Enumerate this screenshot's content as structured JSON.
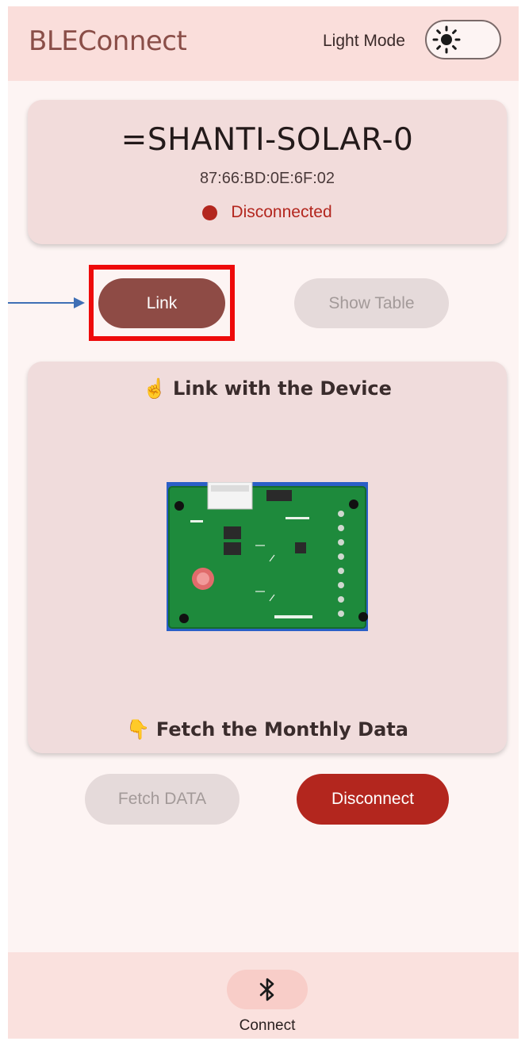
{
  "app": {
    "title": "BLEConnect",
    "mode_label": "Light Mode",
    "mode_icon": "sun-icon"
  },
  "device": {
    "name": "=SHANTI-SOLAR-0",
    "mac": "87:66:BD:0E:6F:02",
    "status": "Disconnected",
    "status_color": "#b3261e"
  },
  "actions": {
    "link_label": "Link",
    "show_table_label": "Show Table",
    "fetch_label": "Fetch DATA",
    "disconnect_label": "Disconnect"
  },
  "info": {
    "top_emoji": "☝️",
    "top_text": "Link with the Device",
    "bottom_emoji": "👇",
    "bottom_text": "Fetch the Monthly Data",
    "image_icon": "circuit-board-image"
  },
  "nav": {
    "items": [
      {
        "label": "Connect",
        "icon": "bluetooth-icon",
        "selected": true
      }
    ]
  },
  "annotation": {
    "highlight_color": "#ee0a0a",
    "arrow_color": "#3f6fb5"
  }
}
